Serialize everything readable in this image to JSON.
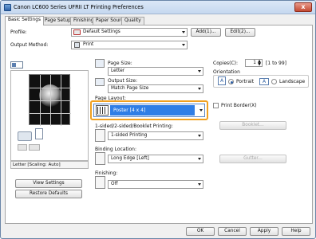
{
  "window": {
    "title": "Canon LC600 Series UFRII LT Printing Preferences",
    "close_label": "x"
  },
  "tabs": [
    {
      "label": "Basic Settings",
      "active": true
    },
    {
      "label": "Page Setup",
      "active": false
    },
    {
      "label": "Finishing",
      "active": false
    },
    {
      "label": "Paper Source",
      "active": false
    },
    {
      "label": "Quality",
      "active": false
    }
  ],
  "profile": {
    "label": "Profile:",
    "value": "Default Settings",
    "add_button": "Add(1)...",
    "edit_button": "Edit(2)..."
  },
  "output_method": {
    "label": "Output Method:",
    "value": "Print"
  },
  "preview": {
    "status_text": "Letter [Scaling: Auto]"
  },
  "page_size": {
    "label": "Page Size:",
    "value": "Letter"
  },
  "output_size": {
    "label": "Output Size:",
    "value": "Match Page Size"
  },
  "page_layout": {
    "label": "Page Layout:",
    "value": "Poster [4 x 4]",
    "print_border_label": "Print Border(X)"
  },
  "copies": {
    "label": "Copies(C):",
    "value": "1",
    "range": "[1 to 99]"
  },
  "orientation": {
    "label": "Orientation",
    "portrait": "Portrait",
    "landscape": "Landscape",
    "selected": "portrait"
  },
  "printing": {
    "label": "1-sided/2-sided/Booklet Printing:",
    "value": "1-sided Printing",
    "booklet_button": "Booklet..."
  },
  "binding": {
    "label": "Binding Location:",
    "value": "Long Edge [Left]",
    "gutter_button": "Gutter..."
  },
  "finishing": {
    "label": "Finishing:",
    "value": "Off"
  },
  "left_buttons": {
    "view_settings": "View Settings",
    "restore_defaults": "Restore Defaults"
  },
  "footer": {
    "ok": "OK",
    "cancel": "Cancel",
    "apply": "Apply",
    "help": "Help"
  },
  "colors": {
    "selected_blue": "#2f7ee6",
    "highlight_orange": "#f0a020"
  }
}
